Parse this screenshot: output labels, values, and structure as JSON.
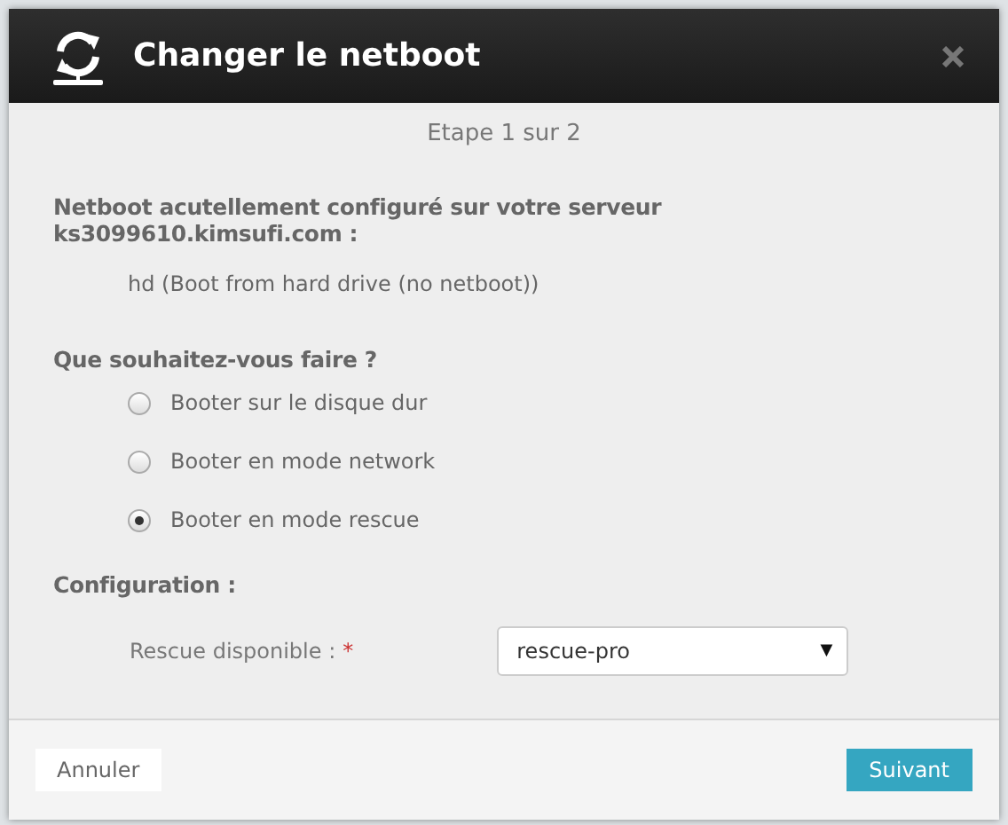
{
  "dialog": {
    "title": "Changer le netboot",
    "step": "Etape 1 sur 2",
    "current_label": "Netboot acutellement configuré sur votre serveur ks3099610.kimsufi.com :",
    "current_value": "hd (Boot from hard drive (no netboot))",
    "question": "Que souhaitez-vous faire ?",
    "options": [
      {
        "label": "Booter sur le disque dur",
        "selected": false
      },
      {
        "label": "Booter en mode network",
        "selected": false
      },
      {
        "label": "Booter en mode rescue",
        "selected": true
      }
    ],
    "config_heading": "Configuration :",
    "field": {
      "label": "Rescue disponible :",
      "required_mark": "*",
      "value": "rescue-pro",
      "caret": "▼"
    },
    "buttons": {
      "cancel": "Annuler",
      "next": "Suivant"
    }
  }
}
